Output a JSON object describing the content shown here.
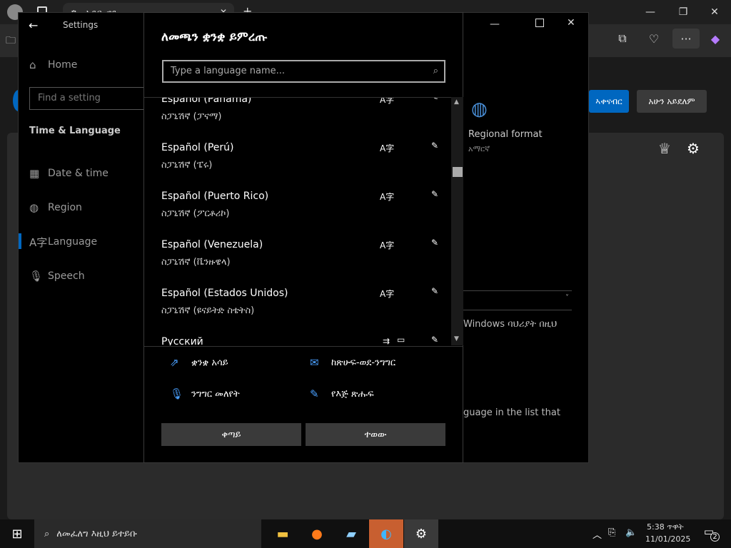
{
  "browser": {
    "tab_title": "ኣዶቤ ኖድ",
    "min": "—",
    "max": "❐",
    "close": "✕",
    "more_icon": "···",
    "copilot_icon": "◆"
  },
  "web": {
    "primary_button": "ኣቀናብር",
    "secondary_button": "አሁን አይደለም"
  },
  "settings": {
    "title": "Settings",
    "home": "Home",
    "search_placeholder": "Find a setting",
    "section": "Time & Language",
    "nav": [
      {
        "label": "Date & time",
        "icon": "calendar-icon"
      },
      {
        "label": "Region",
        "icon": "globe-icon"
      },
      {
        "label": "Language",
        "icon": "language-icon"
      },
      {
        "label": "Speech",
        "icon": "microphone-icon"
      }
    ],
    "regional_format_label": "Regional format",
    "regional_format_value": "አማርኛ",
    "partial_text1": "Windows ባህሪያት በዚህ",
    "partial_text2": "guage in the list that"
  },
  "dialog": {
    "title": "ለመጫን ቋንቋ ይምረጡ",
    "search_placeholder": "Type a language name...",
    "languages": [
      {
        "name": "Español (Panamá)",
        "native": "ስፓኒሽኛ (ፓናማ)"
      },
      {
        "name": "Español (Perú)",
        "native": "ስፓኒሽኛ (ፔሩ)"
      },
      {
        "name": "Español (Puerto Rico)",
        "native": "ስፓኒሽኛ (ፖርቶሪኮ)"
      },
      {
        "name": "Español (Venezuela)",
        "native": "ስፓኒሽኛ (ቬንዙዌላ)"
      },
      {
        "name": "Español (Estados Unidos)",
        "native": "ስፓኒሽኛ (ዩናይትድ ስቴትስ)"
      },
      {
        "name": "Русский",
        "native": ""
      }
    ],
    "features": {
      "display_language": "ቋንቋ አሳይ",
      "text_to_speech": "ከጽሁፍ-ወደ-ንግግር",
      "speech_recognition": "ንግግር መለየት",
      "handwriting": "የእጅ ጽሑፍ"
    },
    "next_button": "ቀጣይ",
    "cancel_button": "ተወው"
  },
  "taskbar": {
    "search_text": "ለመፈለግ እዚህ ይተይቡ",
    "time": "5:38 ጥዋት",
    "date": "11/01/2025",
    "notification_count": "2"
  },
  "colors": {
    "accent": "#0067c0",
    "dialog_bg": "#000000",
    "button_bg": "#3a3a3a"
  }
}
